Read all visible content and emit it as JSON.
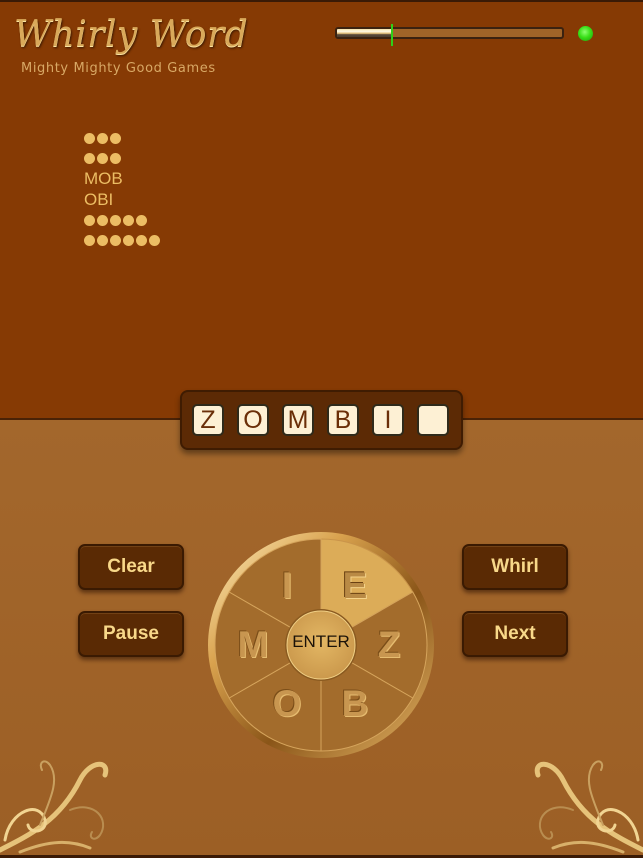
{
  "app": {
    "title": "Whirly Word",
    "subtitle": "Mighty Mighty Good Games"
  },
  "status": {
    "timer_progress": 0.25,
    "status_light": "green",
    "status_light_color": "#3ae019"
  },
  "word_list": [
    {
      "type": "hidden",
      "length": 3
    },
    {
      "type": "hidden",
      "length": 3
    },
    {
      "type": "found",
      "word": "MOB"
    },
    {
      "type": "found",
      "word": "OBI"
    },
    {
      "type": "hidden",
      "length": 5
    },
    {
      "type": "hidden",
      "length": 6
    }
  ],
  "current_word": {
    "tiles": [
      "Z",
      "O",
      "M",
      "B",
      "I",
      ""
    ]
  },
  "buttons": {
    "clear": "Clear",
    "pause": "Pause",
    "whirl": "Whirl",
    "next": "Next",
    "enter": "ENTER"
  },
  "wheel": {
    "letters": [
      {
        "letter": "E",
        "position": "top-right",
        "selected": false,
        "highlighted": true
      },
      {
        "letter": "Z",
        "position": "right",
        "selected": true
      },
      {
        "letter": "B",
        "position": "bottom-right",
        "selected": true
      },
      {
        "letter": "O",
        "position": "bottom-left",
        "selected": true
      },
      {
        "letter": "M",
        "position": "left",
        "selected": true
      },
      {
        "letter": "I",
        "position": "top-left",
        "selected": true
      }
    ]
  },
  "colors": {
    "top_panel": "#863a04",
    "bottom_panel": "#a0652a",
    "accent_gold": "#ecbd64",
    "button_bg": "#5a2a04",
    "button_text": "#f8d889",
    "tile_bg": "#fdf0d4"
  }
}
